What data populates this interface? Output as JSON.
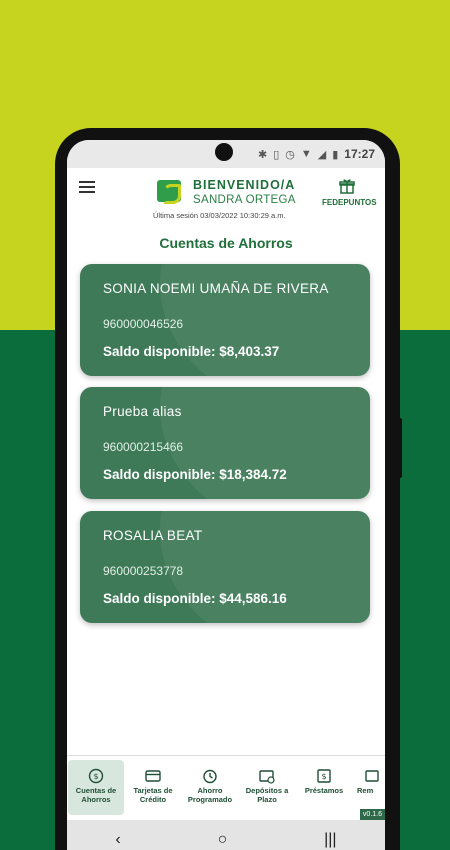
{
  "status_bar": {
    "time": "17:27"
  },
  "header": {
    "welcome": "BIENVENIDO/A",
    "user": "SANDRA ORTEGA",
    "last_session": "Última sesión 03/03/2022 10:30:29 a.m.",
    "rewards_label": "FEDEPUNTOS",
    "accent_color": "#1f6f3a"
  },
  "page_title": "Cuentas de Ahorros",
  "accounts": [
    {
      "name": "SONIA NOEMI  UMAÑA  DE RIVERA",
      "number": "960000046526",
      "balance": "Saldo disponible: $8,403.37"
    },
    {
      "name": "Prueba alias",
      "number": "960000215466",
      "balance": "Saldo disponible: $18,384.72"
    },
    {
      "name": "ROSALIA BEAT",
      "number": "960000253778",
      "balance": "Saldo disponible: $44,586.16"
    }
  ],
  "bottom_nav": [
    {
      "label": "Cuentas de Ahorros",
      "icon": "savings-icon"
    },
    {
      "label": "Tarjetas de Crédito",
      "icon": "credit-card-icon"
    },
    {
      "label": "Ahorro Programado",
      "icon": "scheduled-savings-icon"
    },
    {
      "label": "Depósitos a Plazo",
      "icon": "term-deposit-icon"
    },
    {
      "label": "Préstamos",
      "icon": "loan-icon"
    },
    {
      "label": "Rem",
      "icon": "remittance-icon"
    }
  ],
  "version": "v0.1.6"
}
